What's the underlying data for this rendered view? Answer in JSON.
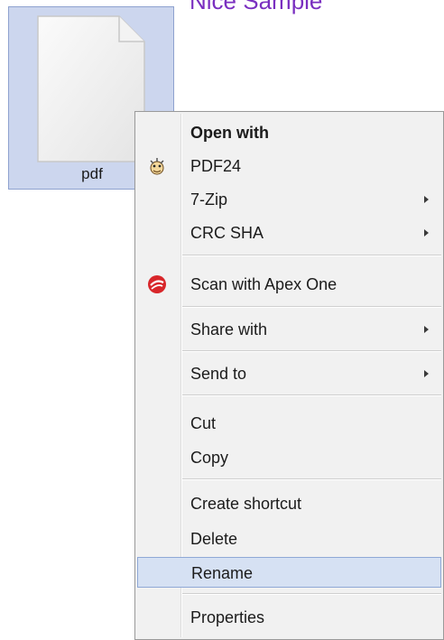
{
  "page": {
    "heading": "Nice Sample"
  },
  "file": {
    "name": "pdf"
  },
  "menu": {
    "items": [
      {
        "id": "open-with",
        "label": "Open with",
        "bold": true,
        "submenu": false,
        "icon": ""
      },
      {
        "id": "pdf24",
        "label": "PDF24",
        "bold": false,
        "submenu": false,
        "icon": "pdf24-icon"
      },
      {
        "id": "7zip",
        "label": "7-Zip",
        "bold": false,
        "submenu": true,
        "icon": ""
      },
      {
        "id": "crc-sha",
        "label": "CRC SHA",
        "bold": false,
        "submenu": true,
        "icon": ""
      },
      {
        "id": "scan",
        "label": "Scan with Apex One",
        "bold": false,
        "submenu": false,
        "icon": "apex-one-icon"
      },
      {
        "id": "share-with",
        "label": "Share with",
        "bold": false,
        "submenu": true,
        "icon": ""
      },
      {
        "id": "send-to",
        "label": "Send to",
        "bold": false,
        "submenu": true,
        "icon": ""
      },
      {
        "id": "cut",
        "label": "Cut",
        "bold": false,
        "submenu": false,
        "icon": ""
      },
      {
        "id": "copy",
        "label": "Copy",
        "bold": false,
        "submenu": false,
        "icon": ""
      },
      {
        "id": "create-shortcut",
        "label": "Create shortcut",
        "bold": false,
        "submenu": false,
        "icon": ""
      },
      {
        "id": "delete",
        "label": "Delete",
        "bold": false,
        "submenu": false,
        "icon": ""
      },
      {
        "id": "rename",
        "label": "Rename",
        "bold": false,
        "submenu": false,
        "icon": "",
        "highlighted": true
      },
      {
        "id": "properties",
        "label": "Properties",
        "bold": false,
        "submenu": false,
        "icon": ""
      }
    ]
  },
  "colors": {
    "selection_bg": "#ccd6ee",
    "menu_bg": "#f1f1f1",
    "highlight_bg": "#d6e1f3",
    "heading": "#7a2fc0",
    "apex_red": "#d8262a"
  }
}
